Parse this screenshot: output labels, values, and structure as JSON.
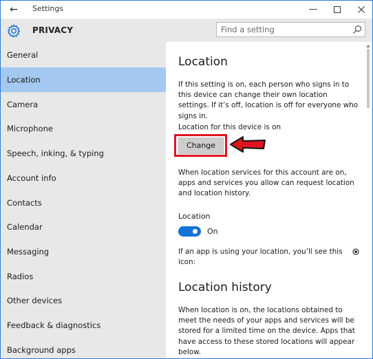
{
  "window": {
    "title": "Settings",
    "back_icon": "arrow-left-icon",
    "minimize_icon": "minimize-icon",
    "maximize_icon": "maximize-icon",
    "close_icon": "close-icon"
  },
  "header": {
    "icon": "gear-icon",
    "title": "PRIVACY",
    "search_placeholder": "Find a setting",
    "search_icon": "search-icon"
  },
  "sidebar": {
    "active_index": 1,
    "items": [
      {
        "label": "General"
      },
      {
        "label": "Location"
      },
      {
        "label": "Camera"
      },
      {
        "label": "Microphone"
      },
      {
        "label": "Speech, inking, & typing"
      },
      {
        "label": "Account info"
      },
      {
        "label": "Contacts"
      },
      {
        "label": "Calendar"
      },
      {
        "label": "Messaging"
      },
      {
        "label": "Radios"
      },
      {
        "label": "Other devices"
      },
      {
        "label": "Feedback & diagnostics"
      },
      {
        "label": "Background apps"
      }
    ]
  },
  "content": {
    "heading": "Location",
    "intro": "If this setting is on, each person who signs in to this device can change their own location settings. If it’s off, location is off for everyone who signs in.",
    "device_status": "Location for this device is on",
    "change_button": "Change",
    "services_text": "When location services for this account are on, apps and services you allow can request location and location history.",
    "location_label": "Location",
    "toggle_state": "On",
    "icon_note": "If an app is using your location, you’ll see this icon:",
    "history_heading": "Location history",
    "history_text": "When location is on, the locations obtained to meet the needs of your apps and services will be stored for a limited time on the device. Apps that have access to these stored locations will appear below."
  },
  "colors": {
    "accent": "#1473d6",
    "active_item": "#a3c9f0",
    "annotation_red": "#e0141e",
    "sidebar_bg": "#e8e8e8"
  }
}
